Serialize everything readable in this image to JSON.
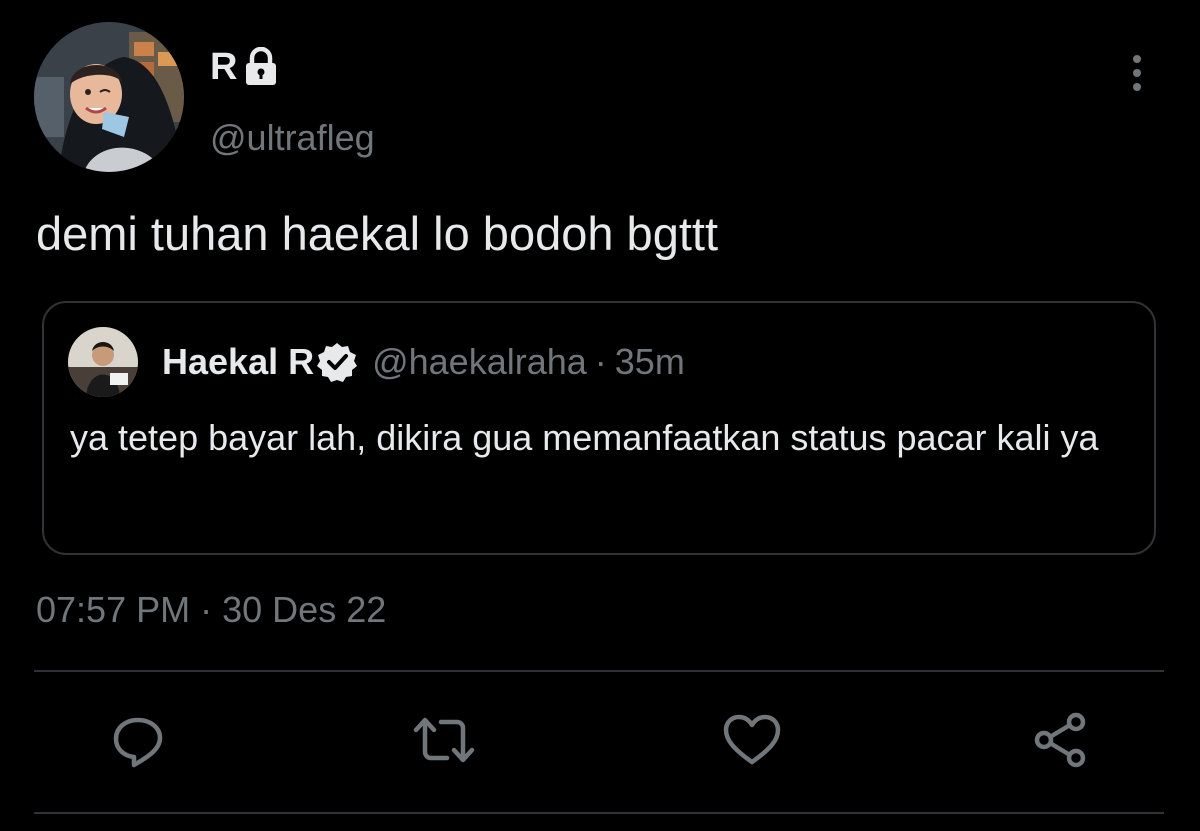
{
  "author": {
    "display_name": "R",
    "handle": "@ultrafleg",
    "locked": true
  },
  "tweet": {
    "text": "demi tuhan haekal lo bodoh bgttt",
    "timestamp": "07:57 PM",
    "separator": "·",
    "date": "30 Des 22"
  },
  "quoted": {
    "display_name": "Haekal R",
    "verified": true,
    "handle": "@haekalraha",
    "separator": "·",
    "time": "35m",
    "text": "ya tetep bayar lah, dikira gua memanfaatkan status pacar kali ya"
  },
  "actions": [
    {
      "name": "reply",
      "icon": "reply-icon"
    },
    {
      "name": "retweet",
      "icon": "retweet-icon"
    },
    {
      "name": "like",
      "icon": "heart-icon"
    },
    {
      "name": "share",
      "icon": "share-icon"
    }
  ],
  "colors": {
    "background": "#000000",
    "primary_text": "#e7e9ea",
    "secondary_text": "#71767b",
    "border": "#2f3336"
  }
}
